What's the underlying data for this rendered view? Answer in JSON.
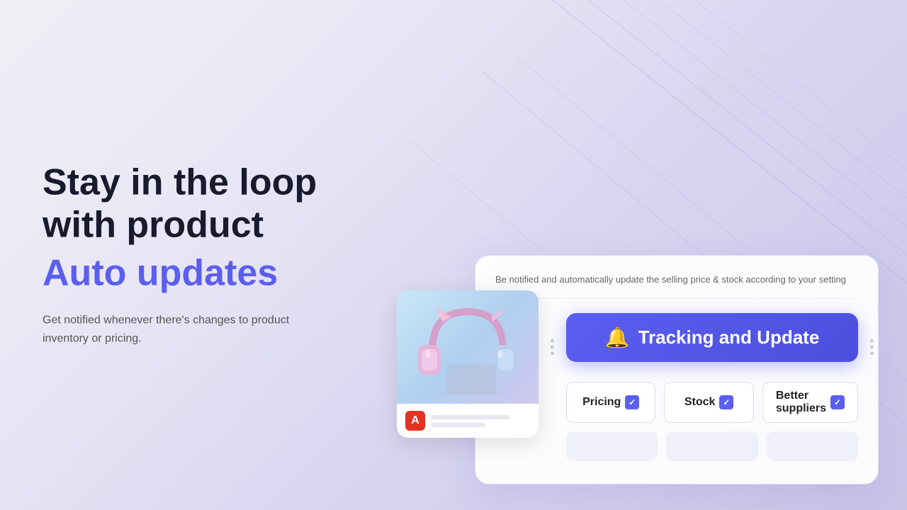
{
  "background": {
    "gradient_start": "#f0eff5",
    "gradient_end": "#c8c4e8"
  },
  "left": {
    "headline_line1": "Stay in the loop",
    "headline_line2": "with product",
    "headline_accent": "Auto updates",
    "description": "Get notified whenever there's changes to product inventory or pricing."
  },
  "right": {
    "info_banner": "Be notified and automatically update the selling price & stock according to your setting",
    "tracking_button_label": "Tracking and Update",
    "bell_icon": "🔔",
    "checkbox_items": [
      {
        "label": "Pricing",
        "checked": true
      },
      {
        "label": "Stock",
        "checked": true
      },
      {
        "label": "Better suppliers",
        "checked": true
      }
    ],
    "shop_icon_label": "A",
    "arrow_left": "‹",
    "arrow_right": "›"
  },
  "colors": {
    "accent_blue": "#5B5FEF",
    "shop_red": "#E43225",
    "text_dark": "#1a1a2e",
    "text_gray": "#555",
    "check_blue": "#5B5FEF"
  }
}
